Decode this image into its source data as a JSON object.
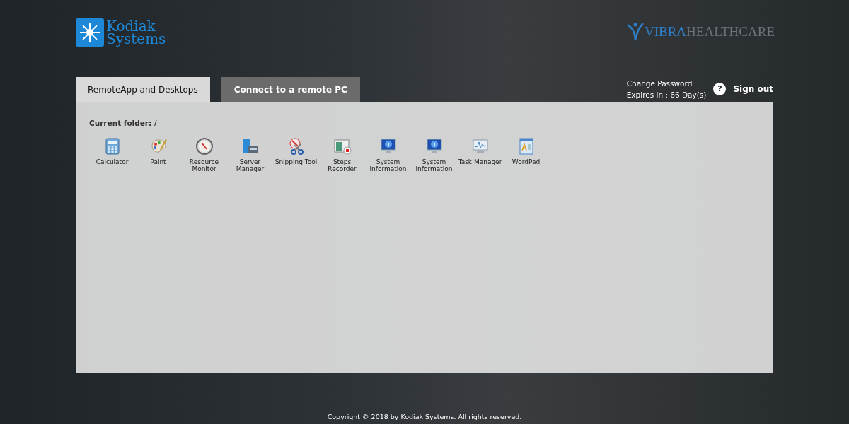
{
  "brand": {
    "line_1": "Kodiak",
    "line_2": "Systems"
  },
  "partner": {
    "part_1": "VIBRA",
    "part_2": "HEALTHCARE"
  },
  "tabs": [
    {
      "label": "RemoteApp and Desktops",
      "selected": true
    },
    {
      "label": "Connect to a remote PC",
      "selected": false
    }
  ],
  "account": {
    "change_password": "Change Password",
    "expires": "Expires in : 66 Day(s)",
    "help": "?",
    "sign_out": "Sign out"
  },
  "folder": "Current folder: /",
  "apps": [
    {
      "kind": "calculator",
      "label": "Calculator"
    },
    {
      "kind": "paint",
      "label": "Paint"
    },
    {
      "kind": "gauge",
      "label": "Resource Monitor"
    },
    {
      "kind": "server",
      "label": "Server Manager"
    },
    {
      "kind": "scissors",
      "label": "Snipping Tool"
    },
    {
      "kind": "recorder",
      "label": "Steps Recorder"
    },
    {
      "kind": "info",
      "label": "System Information"
    },
    {
      "kind": "info",
      "label": "System Information"
    },
    {
      "kind": "monitor",
      "label": "Task Manager"
    },
    {
      "kind": "document",
      "label": "WordPad"
    }
  ],
  "footer": "Copyright © 2018 by Kodiak Systems. All rights reserved."
}
